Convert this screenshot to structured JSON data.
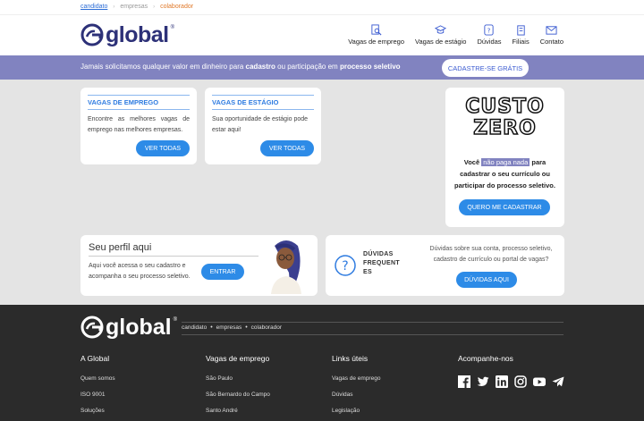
{
  "topbar": {
    "crumbs": [
      "candidato",
      "empresas",
      "colaborador"
    ]
  },
  "header": {
    "logo": "global",
    "nav": [
      {
        "icon": "search-doc-icon",
        "label": "Vagas de emprego"
      },
      {
        "icon": "graduation-cap-icon",
        "label": "Vagas de estágio"
      },
      {
        "icon": "question-icon",
        "label": "Dúvidas"
      },
      {
        "icon": "building-icon",
        "label": "Filiais"
      },
      {
        "icon": "mail-icon",
        "label": "Contato"
      }
    ]
  },
  "banner": {
    "msg_parts": [
      "Jamais solicitamos qualquer valor em dinheiro para ",
      "cadastro",
      " ou participação em ",
      "processo seletivo"
    ],
    "cta": "CADASTRE-SE GRÁTIS"
  },
  "cards": {
    "emprego": {
      "title": "VAGAS DE EMPREGO",
      "text": "Encontre as melhores vagas de emprego nas melhores empresas.",
      "button": "VER TODAS"
    },
    "estagio": {
      "title": "VAGAS DE ESTÁGIO",
      "text": "Sua oportunidade de estágio pode estar aqui!",
      "button": "VER TODAS"
    },
    "custo": {
      "title_line1": "CUSTO",
      "title_line2": "ZERO",
      "text_a": "Você ",
      "highlight": "não paga nada",
      "text_b": " para cadastrar o seu currículo ou participar do processo seletivo.",
      "button": "QUERO ME CADASTRAR"
    },
    "perfil": {
      "title": "Seu perfil aqui",
      "text": "Aqui você acessa o seu cadastro e acompanha o seu processo seletivo.",
      "button": "ENTRAR"
    },
    "duvidas": {
      "title_lines": [
        "DÚVIDAS",
        "FREQUENT",
        "ES"
      ],
      "text": "Dúvidas sobre sua conta, processo seletivo, cadastro de currículo ou portal de vagas?",
      "button": "DÚVIDAS AQUI"
    }
  },
  "footer": {
    "logo": "global",
    "crumbs": [
      "candidato",
      "empresas",
      "colaborador"
    ],
    "columns": [
      {
        "title": "A Global",
        "links": [
          "Quem somos",
          "ISO 9001",
          "Soluções"
        ]
      },
      {
        "title": "Vagas de emprego",
        "links": [
          "São Paulo",
          "São Bernardo do Campo",
          "Santo André"
        ]
      },
      {
        "title": "Links úteis",
        "links": [
          "Vagas de emprego",
          "Dúvidas",
          "Legislação"
        ]
      },
      {
        "title": "Acompanhe-nos",
        "social": [
          "facebook-icon",
          "twitter-icon",
          "linkedin-icon",
          "instagram-icon",
          "youtube-icon",
          "telegram-icon"
        ]
      }
    ]
  },
  "colors": {
    "brand": "#2d3178",
    "accent": "#2d8be7",
    "banner": "#8183c0",
    "footer": "#2b2b2b"
  }
}
